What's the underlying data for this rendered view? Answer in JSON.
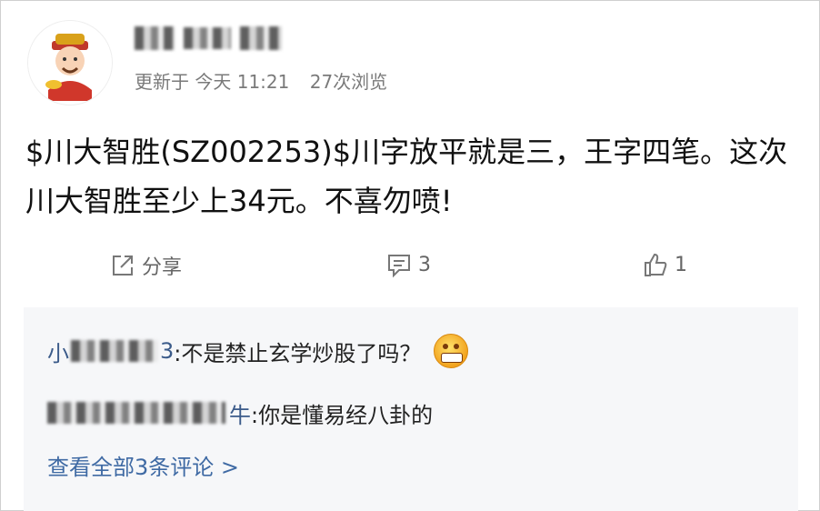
{
  "post": {
    "username_masked": "▮▮▮ ▮▮ ▮▮ɔ",
    "meta": {
      "updated": "更新于 今天 11:21",
      "views": "27次浏览"
    },
    "content": "$川大智胜(SZ002253)$川字放平就是三，王字四笔。这次川大智胜至少上34元。不喜勿喷!"
  },
  "actions": {
    "share_label": "分享",
    "comment_count": "3",
    "like_count": "1"
  },
  "comments": [
    {
      "name_masked": "小▮▮▮▮3",
      "text": ":不是禁止玄学炒股了吗？",
      "emoji": "grin-emoji"
    },
    {
      "name_masked": "▮▮▮▮▮▮牛",
      "text": ":你是懂易经八卦的"
    }
  ],
  "view_all_label": "查看全部3条评论 >",
  "colors": {
    "link": "#3f6aa4",
    "muted": "#7a7a7a",
    "comment_bg": "#f6f7f9"
  }
}
